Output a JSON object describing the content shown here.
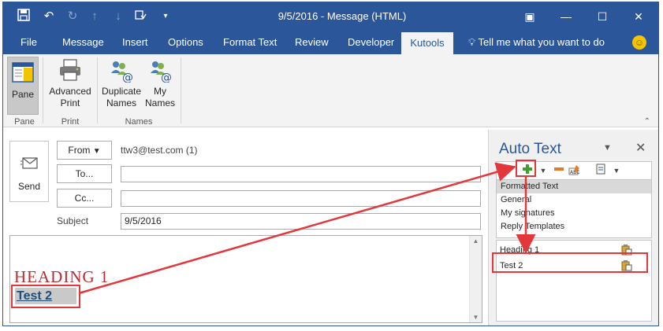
{
  "window": {
    "title": "9/5/2016  -  Message (HTML)"
  },
  "quick_access": {
    "save_icon": "save-icon",
    "undo_icon": "undo-icon",
    "redo_icon": "redo-icon"
  },
  "window_controls": {
    "restore": "▣",
    "minimize": "—",
    "maximize": "☐",
    "close": "✕"
  },
  "menu": {
    "tabs": [
      "File",
      "Message",
      "Insert",
      "Options",
      "Format Text",
      "Review",
      "Developer",
      "Kutools"
    ],
    "active_tab": "Kutools",
    "tell_me": "Tell me what you want to do"
  },
  "ribbon": {
    "pane_label": "Pane",
    "advanced_print_line1": "Advanced",
    "advanced_print_line2": "Print",
    "duplicate_names_line1": "Duplicate",
    "duplicate_names_line2": "Names",
    "my_names_line1": "My",
    "my_names_line2": "Names",
    "groups": {
      "pane": "Pane",
      "print": "Print",
      "names": "Names"
    }
  },
  "compose": {
    "send_label": "Send",
    "from_label": "From",
    "from_value": "ttw3@test.com (1)",
    "to_label": "To...",
    "cc_label": "Cc...",
    "subject_label": "Subject",
    "subject_value": "9/5/2016",
    "heading_text": "HEADING 1",
    "body_text": "Test 2"
  },
  "auto_text": {
    "title": "Auto Text",
    "categories": [
      "Formatted Text",
      "General",
      "My signatures",
      "Reply Templates"
    ],
    "selected_category": "Formatted Text",
    "entries": [
      "Heading 1",
      "Test 2"
    ]
  },
  "colors": {
    "accent": "#2b579a",
    "highlight": "#e2383b",
    "heading": "#c0282d"
  }
}
